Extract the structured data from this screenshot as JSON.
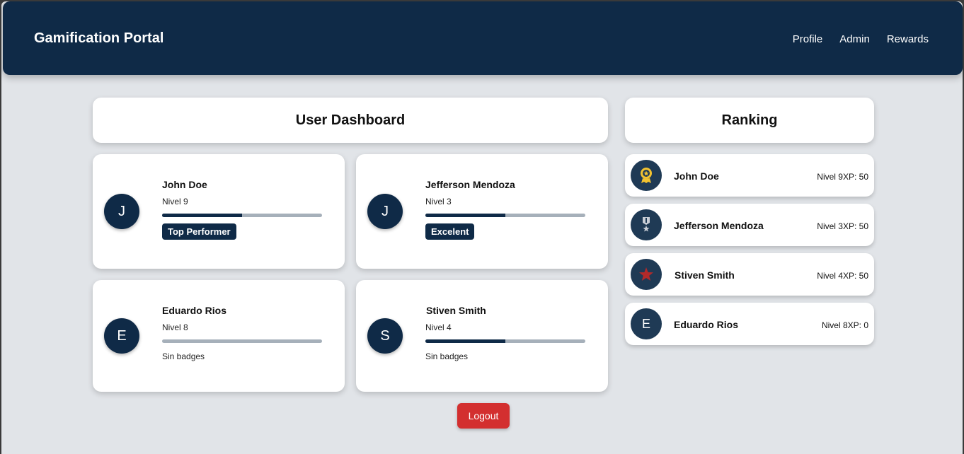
{
  "app": {
    "title": "Gamification Portal"
  },
  "nav": {
    "links": [
      "Profile",
      "Admin",
      "Rewards"
    ]
  },
  "dashboard": {
    "title": "User Dashboard",
    "users": [
      {
        "initial": "J",
        "name": "John Doe",
        "level": "Nivel 9",
        "progress_percent": 50,
        "badge": "Top Performer"
      },
      {
        "initial": "J",
        "name": "Jefferson Mendoza",
        "level": "Nivel 3",
        "progress_percent": 50,
        "badge": "Excelent"
      },
      {
        "initial": "E",
        "name": "Eduardo Rios",
        "level": "Nivel 8",
        "progress_percent": 0,
        "badge": "Sin badges"
      },
      {
        "initial": "S",
        "name": "Stiven Smith",
        "level": "Nivel 4",
        "progress_percent": 50,
        "badge": "Sin badges"
      }
    ]
  },
  "ranking": {
    "title": "Ranking",
    "items": [
      {
        "icon": "gold-medal-icon",
        "name": "John Doe",
        "stats": "Nivel 9XP: 50"
      },
      {
        "icon": "silver-medal-icon",
        "name": "Jefferson Mendoza",
        "stats": "Nivel 3XP: 50"
      },
      {
        "icon": "star-icon",
        "name": "Stiven Smith",
        "stats": "Nivel 4XP: 50"
      },
      {
        "icon": "initial-avatar",
        "initial": "E",
        "name": "Eduardo Rios",
        "stats": "Nivel 8XP: 0"
      }
    ]
  },
  "actions": {
    "logout_label": "Logout"
  },
  "colors": {
    "navy": "#0f2a47",
    "logout": "#d32f2f",
    "background": "#e1e4e8",
    "progress_track": "#a6b0ba"
  }
}
